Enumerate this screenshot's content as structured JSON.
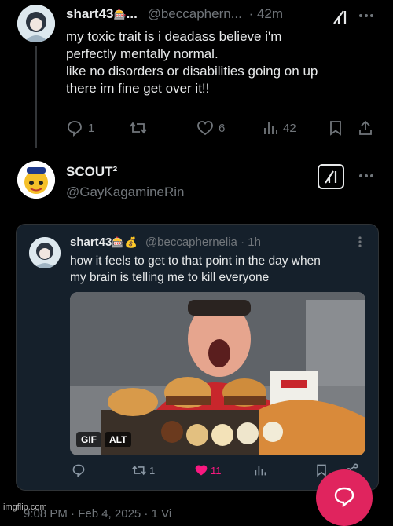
{
  "tweet1": {
    "display_name": "shart43",
    "name_emoji": "🎰",
    "ellipsis": "...",
    "handle": "@beccaphern...",
    "time": "· 42m",
    "text_line1": "my toxic trait is i deadass believe i'm",
    "text_line2": "perfectly mentally normal.",
    "text_line3": "like no disorders or disabilities going on up",
    "text_line4": "there im fine get over it!!",
    "replies": "1",
    "likes": "6",
    "views": "42"
  },
  "tweet2": {
    "display_name": "SCOUT²",
    "handle": "@GayKagamineRin"
  },
  "quote": {
    "display_name": "shart43",
    "name_emoji": "🎰💰",
    "handle": "@beccaphernelia",
    "time": "· 1h",
    "text_line1": "how it feels to get to that point in the day when",
    "text_line2": "my brain is telling me to kill everyone",
    "gif_badge": "GIF",
    "alt_badge": "ALT",
    "retweets": "1",
    "likes": "11"
  },
  "footer": {
    "timestamp_partial": "9:08 PM · Feb 4, 2025 · 1 Vi",
    "watermark": "imgflip.com"
  },
  "colors": {
    "background": "#000000",
    "text": "#e7e9ea",
    "muted": "#71767b",
    "like_pink": "#f91880",
    "compose_button": "#e0245e"
  },
  "icons": {
    "reply": "reply-icon",
    "retweet": "retweet-icon",
    "like": "heart-icon",
    "views": "views-icon",
    "bookmark": "bookmark-icon",
    "share": "share-icon",
    "more": "more-icon",
    "grok": "grok-icon",
    "compose": "compose-icon"
  }
}
